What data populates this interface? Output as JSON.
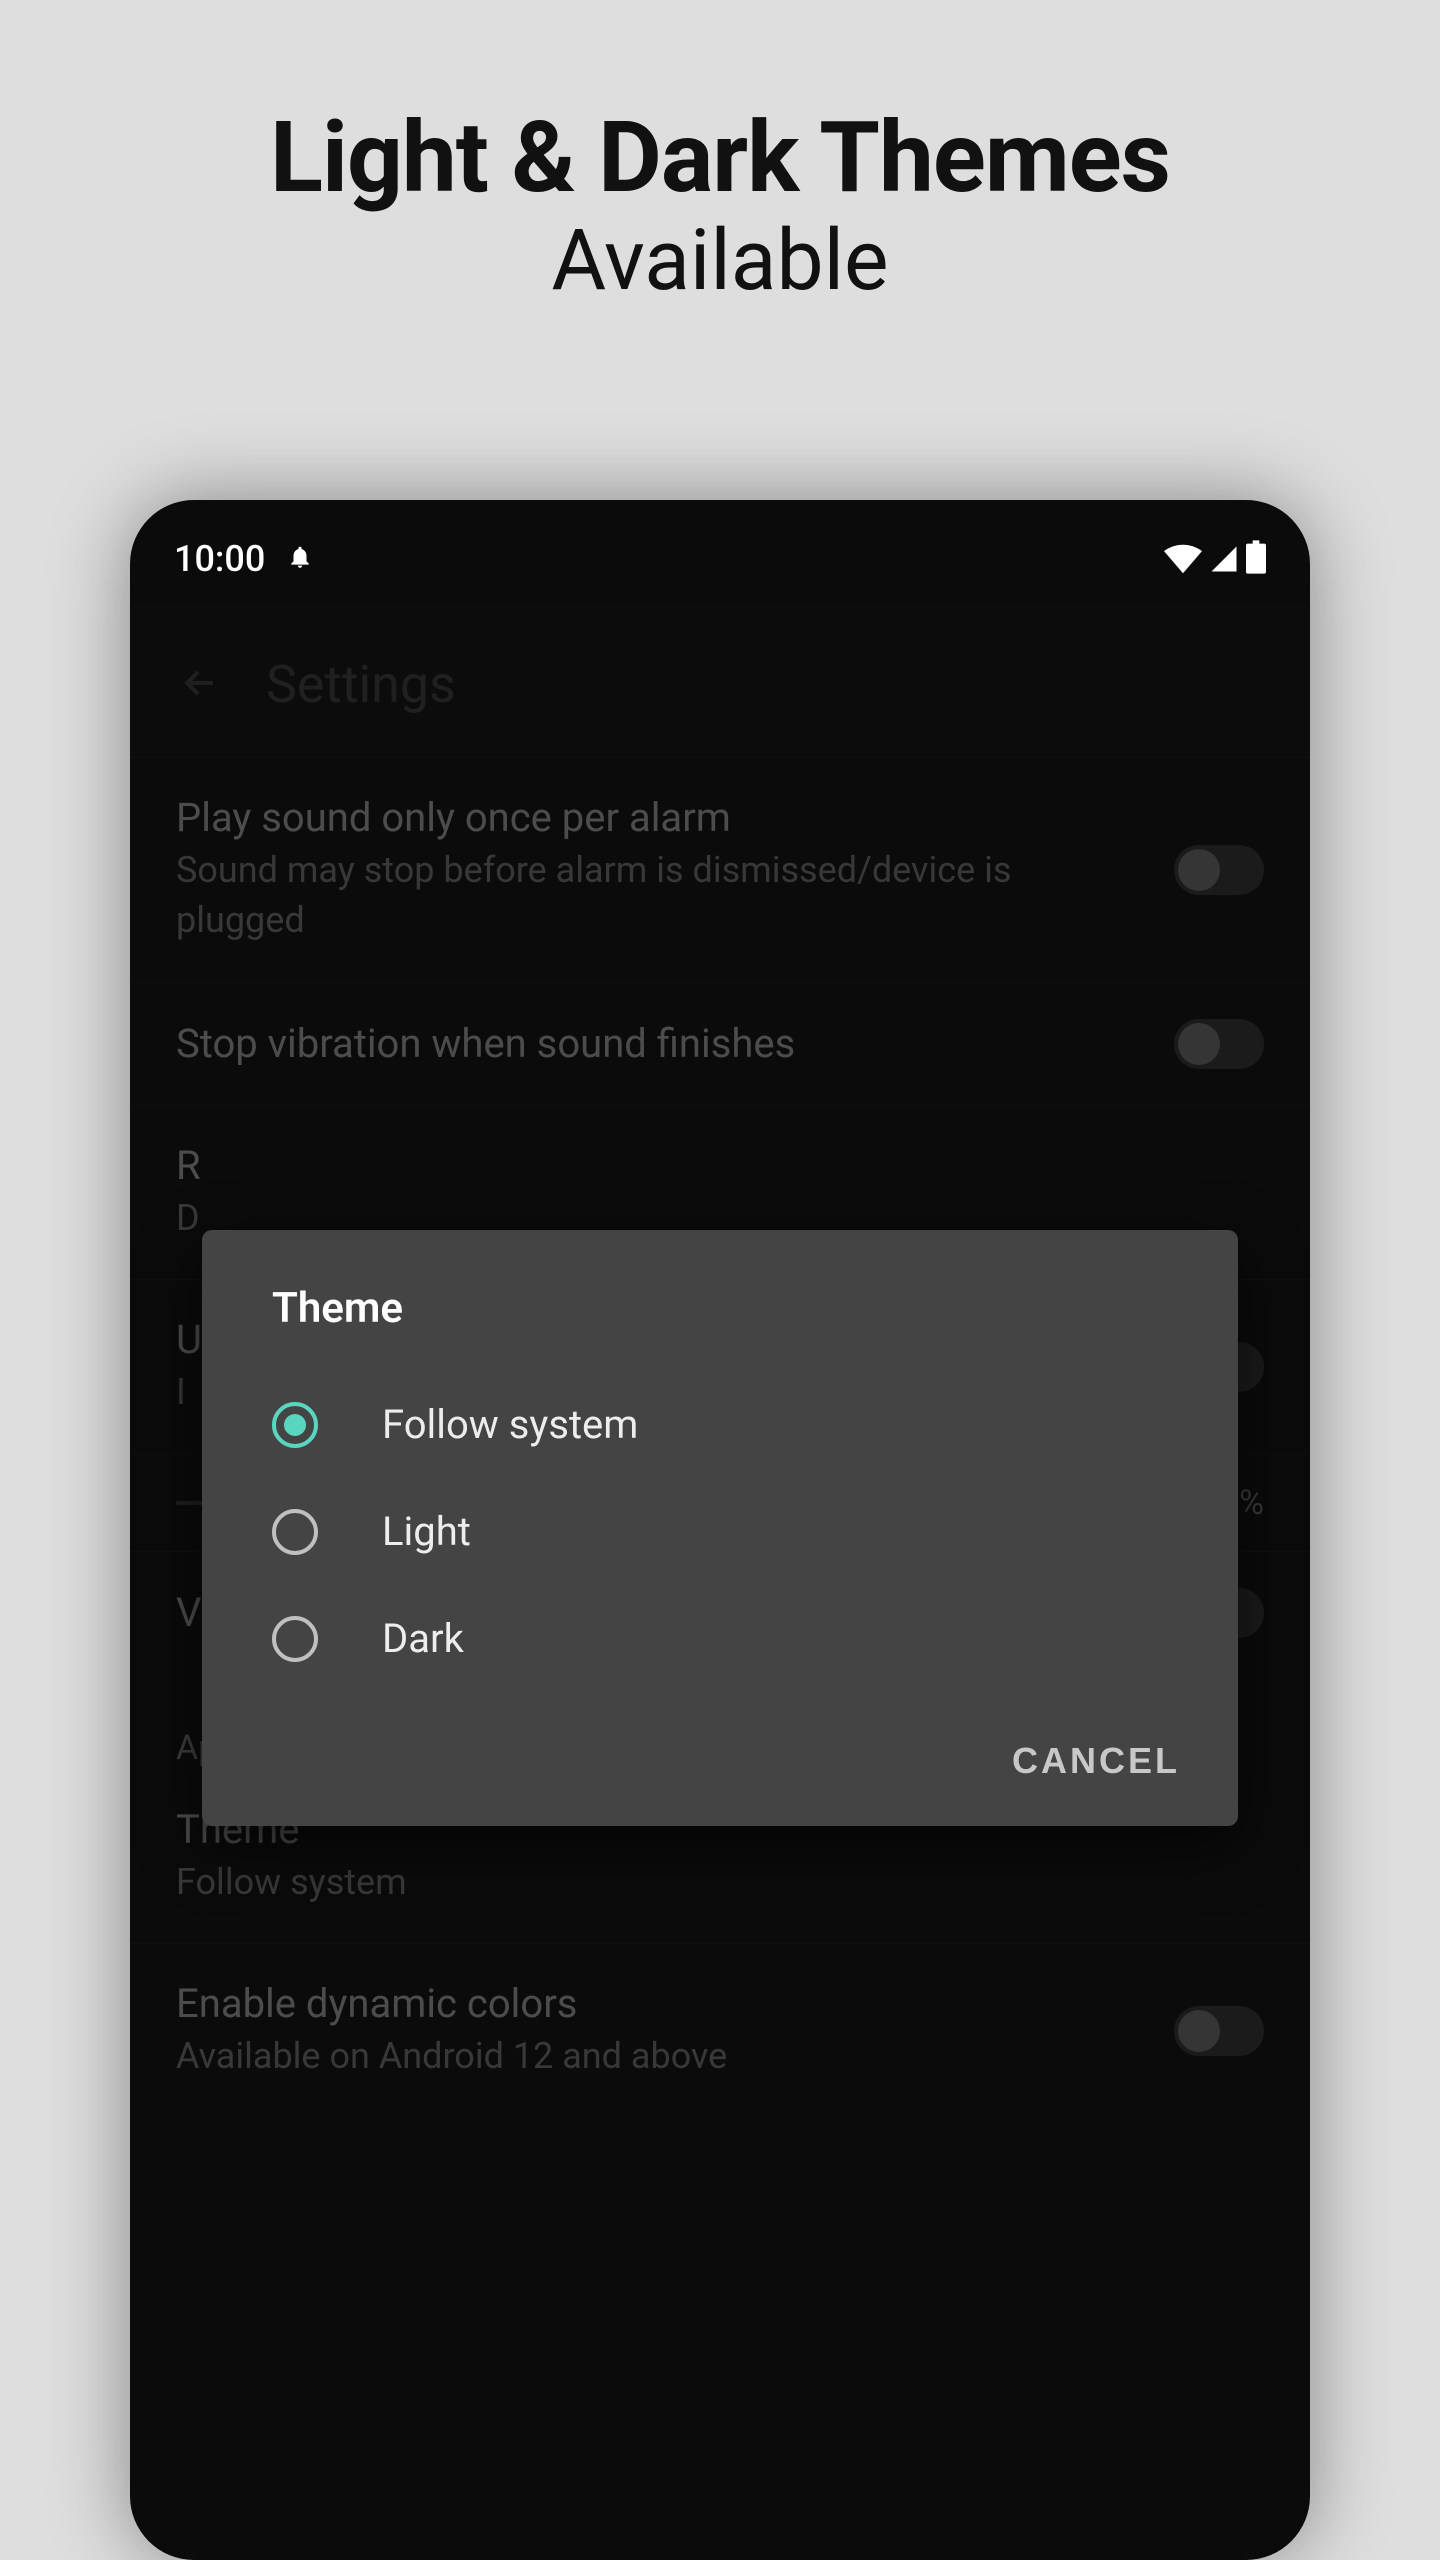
{
  "promo": {
    "line1": "Light & Dark Themes",
    "line2": "Available"
  },
  "status_bar": {
    "time": "10:00",
    "icons": {
      "bell": "notification-bell",
      "wifi": "wifi",
      "signal": "cellular",
      "battery": "battery-full"
    }
  },
  "app_bar": {
    "back_icon": "arrow-back",
    "title": "Settings"
  },
  "settings": {
    "item1": {
      "title": "Play sound only once per alarm",
      "subtitle": "Sound may stop before alarm is dismissed/device is plugged",
      "toggle_on": false
    },
    "item2": {
      "title": "Stop vibration when sound finishes",
      "toggle_on": false
    },
    "item3": {
      "title_prefix": "R",
      "subtitle_prefix": "D"
    },
    "item4": {
      "title_prefix": "U",
      "subtitle_prefix": "I",
      "toggle_on": false
    },
    "slider": {
      "value_label": "%"
    },
    "item5": {
      "title_prefix": "V",
      "toggle_on": false
    },
    "section_appearance": "Appearance",
    "theme_row": {
      "title": "Theme",
      "subtitle": "Follow system"
    },
    "dynamic_colors": {
      "title": "Enable dynamic colors",
      "subtitle": "Available on Android 12 and above",
      "toggle_on": false
    }
  },
  "dialog": {
    "title": "Theme",
    "options": [
      {
        "label": "Follow system",
        "selected": true
      },
      {
        "label": "Light",
        "selected": false
      },
      {
        "label": "Dark",
        "selected": false
      }
    ],
    "cancel_label": "CANCEL"
  },
  "colors": {
    "accent": "#5ad6c0",
    "dialog_bg": "#444444",
    "page_bg": "#dedede",
    "phone_bg": "#0b0b0b"
  }
}
